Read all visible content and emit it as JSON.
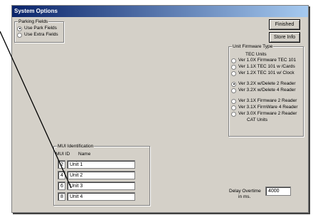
{
  "window": {
    "title": "System Options"
  },
  "parking": {
    "legend": "Parking Fields",
    "options": [
      {
        "label": "Use Park Fields",
        "selected": true
      },
      {
        "label": "Use Extra Fields",
        "selected": false
      }
    ]
  },
  "buttons": {
    "finished": "Finished",
    "store_info": "Store Info"
  },
  "firmware": {
    "legend": "Unit Firmware Type",
    "tec_header": "TEC Units",
    "options": [
      {
        "label": "Ver 1.0X Firmware TEC 101",
        "selected": false
      },
      {
        "label": "Ver 1.1X TEC 101 w /Cards",
        "selected": false
      },
      {
        "label": "Ver 1.2X TEC 101 w/ Clock",
        "selected": false
      },
      {
        "label": "Ver 3.2X w/Delete 2 Reader",
        "selected": true
      },
      {
        "label": "Ver 3.2X w/Delete 4 Reader",
        "selected": false
      },
      {
        "label": "Ver 3.1X Firmware 2 Reader",
        "selected": false
      },
      {
        "label": "Ver 3.1X FirmWare 4 Reader",
        "selected": false
      },
      {
        "label": "Ver 3.0X Firmware 2 Reader",
        "selected": false
      }
    ],
    "cat_units": "CAT Units"
  },
  "mui": {
    "legend": "MUI Identification",
    "col_id": "MUI ID",
    "col_name": "Name",
    "rows": [
      {
        "id": "2",
        "name": "Unit 1"
      },
      {
        "id": "4",
        "name": "Unit 2"
      },
      {
        "id": "6",
        "name": "Unit 3"
      },
      {
        "id": "8",
        "name": "Unit 4"
      }
    ]
  },
  "delay": {
    "label": "Delay  Overtime",
    "unit": "in ms.",
    "value": "4000"
  }
}
